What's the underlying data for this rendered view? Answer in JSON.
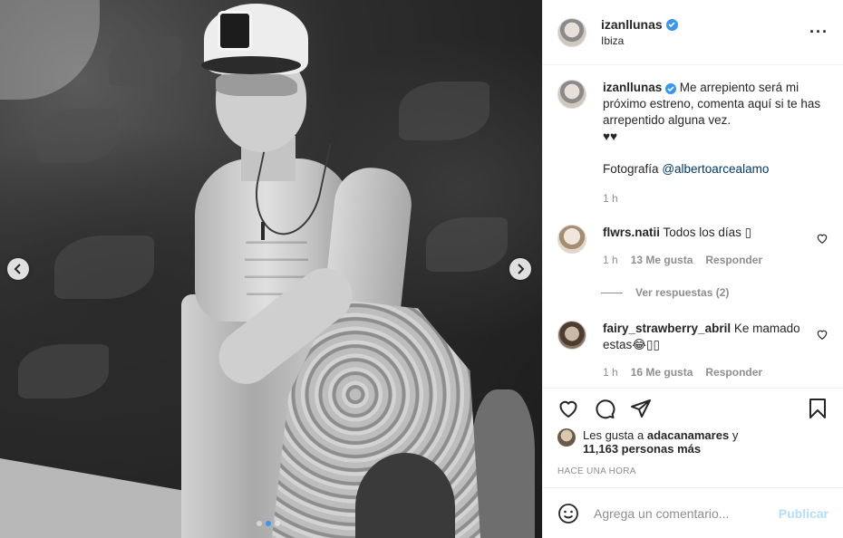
{
  "post": {
    "author": {
      "username": "izanllunas",
      "location": "Ibiza"
    },
    "caption": {
      "username": "izanllunas",
      "text": "Me arrepiento será mi próximo estreno, comenta aquí si te has arrepentido alguna vez.",
      "emoji": "♥♥",
      "credit_prefix": "Fotografía",
      "credit_mention": "@albertoarcealamo",
      "time": "1 h"
    },
    "comments": [
      {
        "username": "flwrs.natii",
        "text": "Todos los días ▯",
        "time": "1 h",
        "likes": "13 Me gusta",
        "reply": "Responder",
        "view_replies": "Ver respuestas (2)"
      },
      {
        "username": "fairy_strawberry_abril",
        "text": "Ke mamado estas😂▯▯",
        "time": "1 h",
        "likes": "16 Me gusta",
        "reply": "Responder"
      }
    ],
    "likes": {
      "prefix": "Les gusta a",
      "user": "adacanamares",
      "joiner": "y",
      "count": "11,163 personas más"
    },
    "timestamp": "HACE UNA HORA",
    "composer": {
      "placeholder": "Agrega un comentario...",
      "publish": "Publicar"
    },
    "carousel": {
      "count": 3,
      "active": 1
    },
    "colors": {
      "accent": "#3897f0",
      "link": "#00376b",
      "muted": "#8e8e8e",
      "publish_disabled": "#b2dffc"
    },
    "icons": [
      "more-options-icon",
      "verified-badge-icon",
      "heart-icon",
      "comment-icon",
      "share-icon",
      "bookmark-icon",
      "emoji-icon",
      "chevron-left-icon",
      "chevron-right-icon"
    ]
  }
}
